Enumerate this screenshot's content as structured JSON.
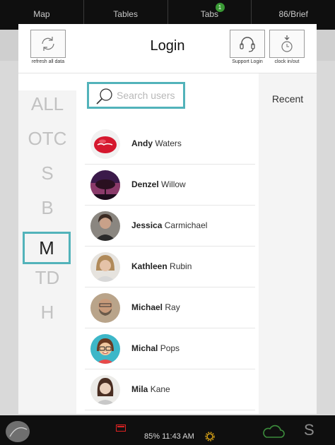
{
  "top_tabs": [
    {
      "label": "Map"
    },
    {
      "label": "Tables"
    },
    {
      "label": "Tabs",
      "badge": "1"
    },
    {
      "label": "86/Brief"
    }
  ],
  "header": {
    "title": "Login",
    "refresh_label": "refresh all data",
    "support_label": "Support Login",
    "clock_label": "clock in/out"
  },
  "letters": [
    "ALL",
    "OTC",
    "S",
    "B",
    "M",
    "TD",
    "H"
  ],
  "active_letter": "M",
  "search": {
    "placeholder": "Search users"
  },
  "users": [
    {
      "first": "Andy",
      "last": "Waters"
    },
    {
      "first": "Denzel",
      "last": "Willow"
    },
    {
      "first": "Jessica",
      "last": "Carmichael"
    },
    {
      "first": "Kathleen",
      "last": "Rubin"
    },
    {
      "first": "Michael",
      "last": "Ray"
    },
    {
      "first": "Michal",
      "last": "Pops"
    },
    {
      "first": "Mila",
      "last": "Kane"
    }
  ],
  "recent_label": "Recent",
  "status": {
    "battery": "85%",
    "time": "11:43 AM"
  },
  "bottom_right_letter": "S",
  "colors": {
    "accent": "#52b3ba",
    "badge": "#3a9a35",
    "cloud": "#3c8c3c"
  }
}
